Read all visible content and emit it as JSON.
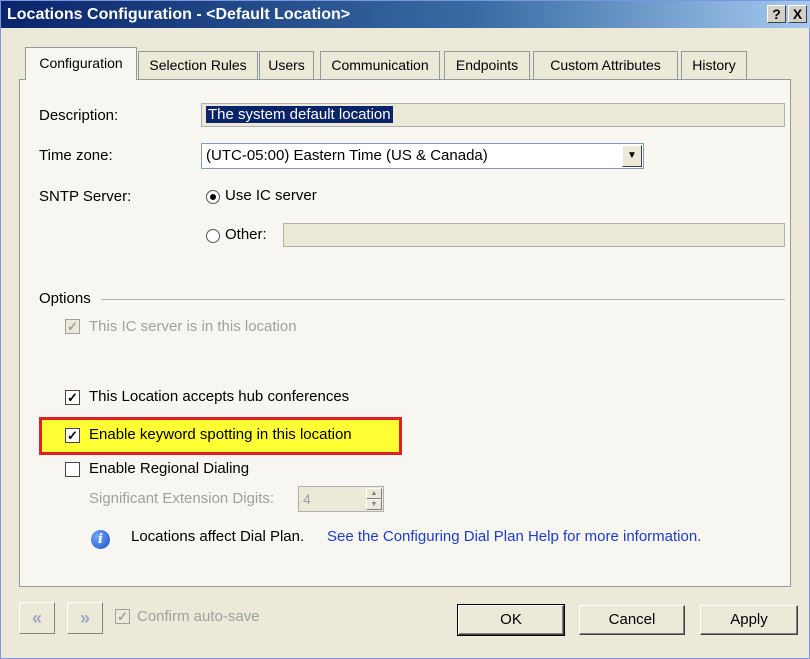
{
  "window": {
    "title": "Locations Configuration - <Default Location>",
    "help_glyph": "?",
    "close_glyph": "X"
  },
  "tabs": [
    {
      "label": "Configuration",
      "active": true
    },
    {
      "label": "Selection Rules",
      "active": false
    },
    {
      "label": "Users",
      "active": false
    },
    {
      "label": "Communication",
      "active": false
    },
    {
      "label": "Endpoints",
      "active": false
    },
    {
      "label": "Custom Attributes",
      "active": false
    },
    {
      "label": "History",
      "active": false
    }
  ],
  "fields": {
    "description_label": "Description:",
    "description_value": "The system default location",
    "timezone_label": "Time zone:",
    "timezone_value": "(UTC-05:00) Eastern Time (US & Canada)",
    "sntp_label": "SNTP Server:",
    "use_ic_label": "Use IC server",
    "other_label": "Other:",
    "other_value": ""
  },
  "options": {
    "group_label": "Options",
    "ic_server_here": {
      "label": "This IC server is in this location",
      "checked": true,
      "enabled": false
    },
    "hub_conferences": {
      "label": "This Location accepts hub conferences",
      "checked": true
    },
    "keyword_spotting": {
      "label": "Enable keyword spotting in this location",
      "checked": true
    },
    "regional_dialing": {
      "label": "Enable Regional Dialing",
      "checked": false
    },
    "sig_digits_label": "Significant Extension Digits:",
    "sig_digits_value": "4",
    "info_text": "Locations affect Dial Plan.",
    "info_link": "See the Configuring Dial Plan Help for more information."
  },
  "footer": {
    "prev_glyph": "«",
    "next_glyph": "»",
    "confirm_autosave_label": "Confirm auto-save",
    "confirm_autosave_checked": true,
    "ok_label": "OK",
    "cancel_label": "Cancel",
    "apply_label": "Apply"
  },
  "colors": {
    "highlight_fill": "#ffff33",
    "highlight_border": "#e02020",
    "link": "#1e3cc8"
  }
}
